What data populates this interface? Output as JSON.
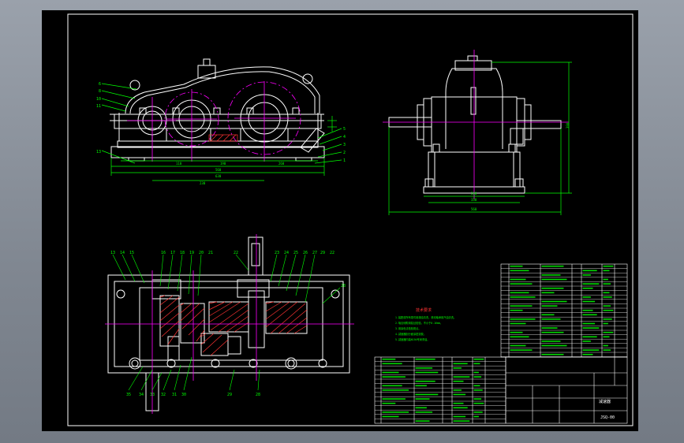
{
  "canvas": {
    "background": "#000000",
    "frame_color": "#ffffff"
  },
  "colors": {
    "outline": "#ffffff",
    "dimension": "#00ff00",
    "centerline": "#ff00ff",
    "leader": "#ffff00",
    "hatch": "#ff3333",
    "hidden": "#ffff00",
    "note_title": "#ff3333",
    "table_text": "#00ff00"
  },
  "front_view": {
    "part_labels_left": [
      "6",
      "8",
      "10",
      "11",
      "13"
    ],
    "part_labels_right": [
      "5",
      "4",
      "3",
      "2",
      "1"
    ]
  },
  "top_view": {
    "labels_top": [
      "13",
      "14",
      "15",
      "16",
      "17",
      "18",
      "19",
      "20",
      "21",
      "22",
      "23",
      "24",
      "25",
      "26",
      "27",
      "28",
      "29",
      "22"
    ],
    "labels_bottom": [
      "35",
      "34",
      "33",
      "32",
      "31",
      "30",
      "29",
      "28"
    ]
  },
  "notes": {
    "title": "技术要求",
    "lines": [
      "1.装配前所有零件用煤油清洗，滚动轴承用汽油清洗。",
      "2.啮合侧隙用铅丝检验，不小于0.16mm。",
      "3.用涂色法检验斑点。",
      "4.减速器剖分面涂密封胶。",
      "5.减速器内装N150号润滑油。"
    ]
  },
  "title_block": {
    "drawing_name": "减速器",
    "drawing_number": "JSQ-00"
  }
}
